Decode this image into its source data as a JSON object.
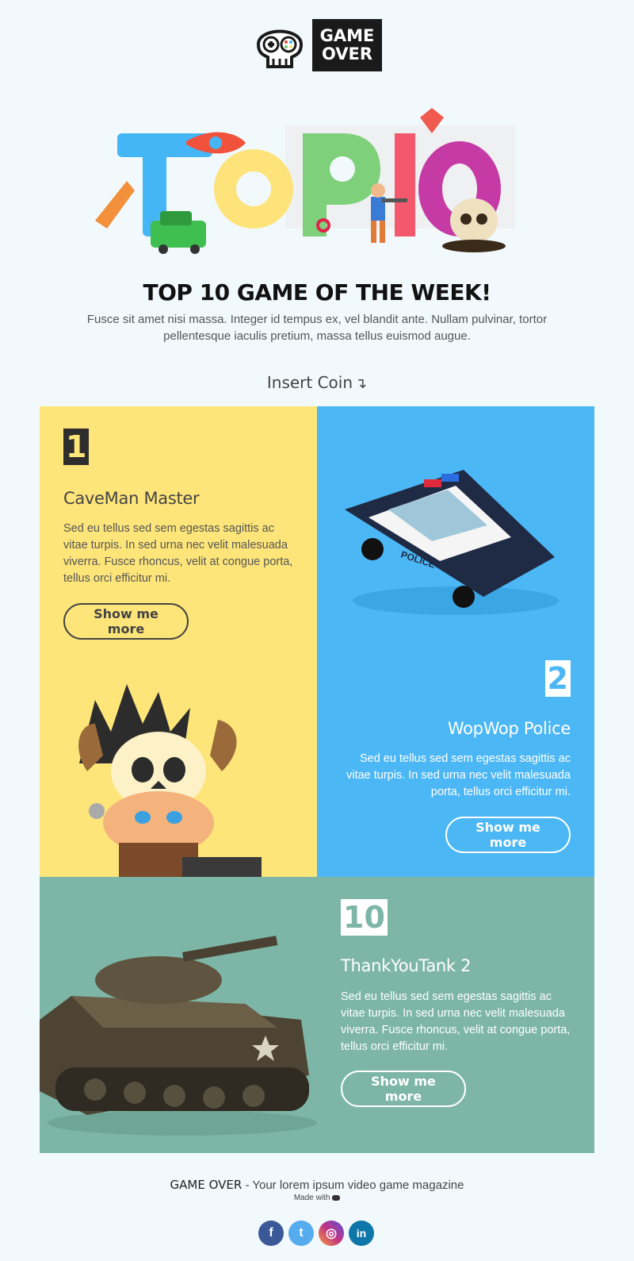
{
  "brand": {
    "logo_line1": "GAME",
    "logo_line2": "OVER"
  },
  "hero": {
    "title_art": "TOP10"
  },
  "headline": "TOP 10 GAME OF THE WEEK!",
  "intro": "Fusce sit amet nisi massa. Integer id tempus ex, vel blandit ante. Nullam pulvinar, tortor pellentesque iaculis pretium, massa tellus euismod augue.",
  "insert_coin": {
    "label": "Insert Coin",
    "arrow": "↴"
  },
  "games": [
    {
      "rank": "1",
      "title": "CaveMan Master",
      "description": "Sed eu tellus sed sem egestas sagittis ac vitae turpis. In sed urna nec velit malesuada viverra. Fusce rhoncus, velit at congue porta, tellus orci efficitur mi.",
      "button": "Show me more",
      "color": "#fde57a"
    },
    {
      "rank": "2",
      "title": "WopWop Police",
      "description": "Sed eu tellus sed sem egestas sagittis ac vitae turpis. In sed urna nec velit malesuada porta, tellus orci efficitur mi.",
      "button": "Show me more",
      "color": "#4cb7f5"
    },
    {
      "rank": "10",
      "title": "ThankYouTank 2",
      "description": "Sed eu tellus sed sem egestas sagittis ac vitae turpis. In sed urna nec velit malesuada viverra. Fusce rhoncus, velit at congue porta, tellus orci efficitur mi.",
      "button": "Show me more",
      "color": "#7db6a6"
    }
  ],
  "police_car_text": "POLICE",
  "footer": {
    "brand": "GAME OVER",
    "tagline": " - Your lorem ipsum video game magazine",
    "made_with": "Made with",
    "made_icon": "gamepad-icon"
  },
  "socials": [
    {
      "name": "facebook",
      "glyph": "f",
      "color": "#3b5998"
    },
    {
      "name": "twitter",
      "glyph": "t",
      "color": "#55acee"
    },
    {
      "name": "instagram",
      "glyph": "◎",
      "color": "#c13584"
    },
    {
      "name": "linkedin",
      "glyph": "in",
      "color": "#0e76a8"
    }
  ]
}
